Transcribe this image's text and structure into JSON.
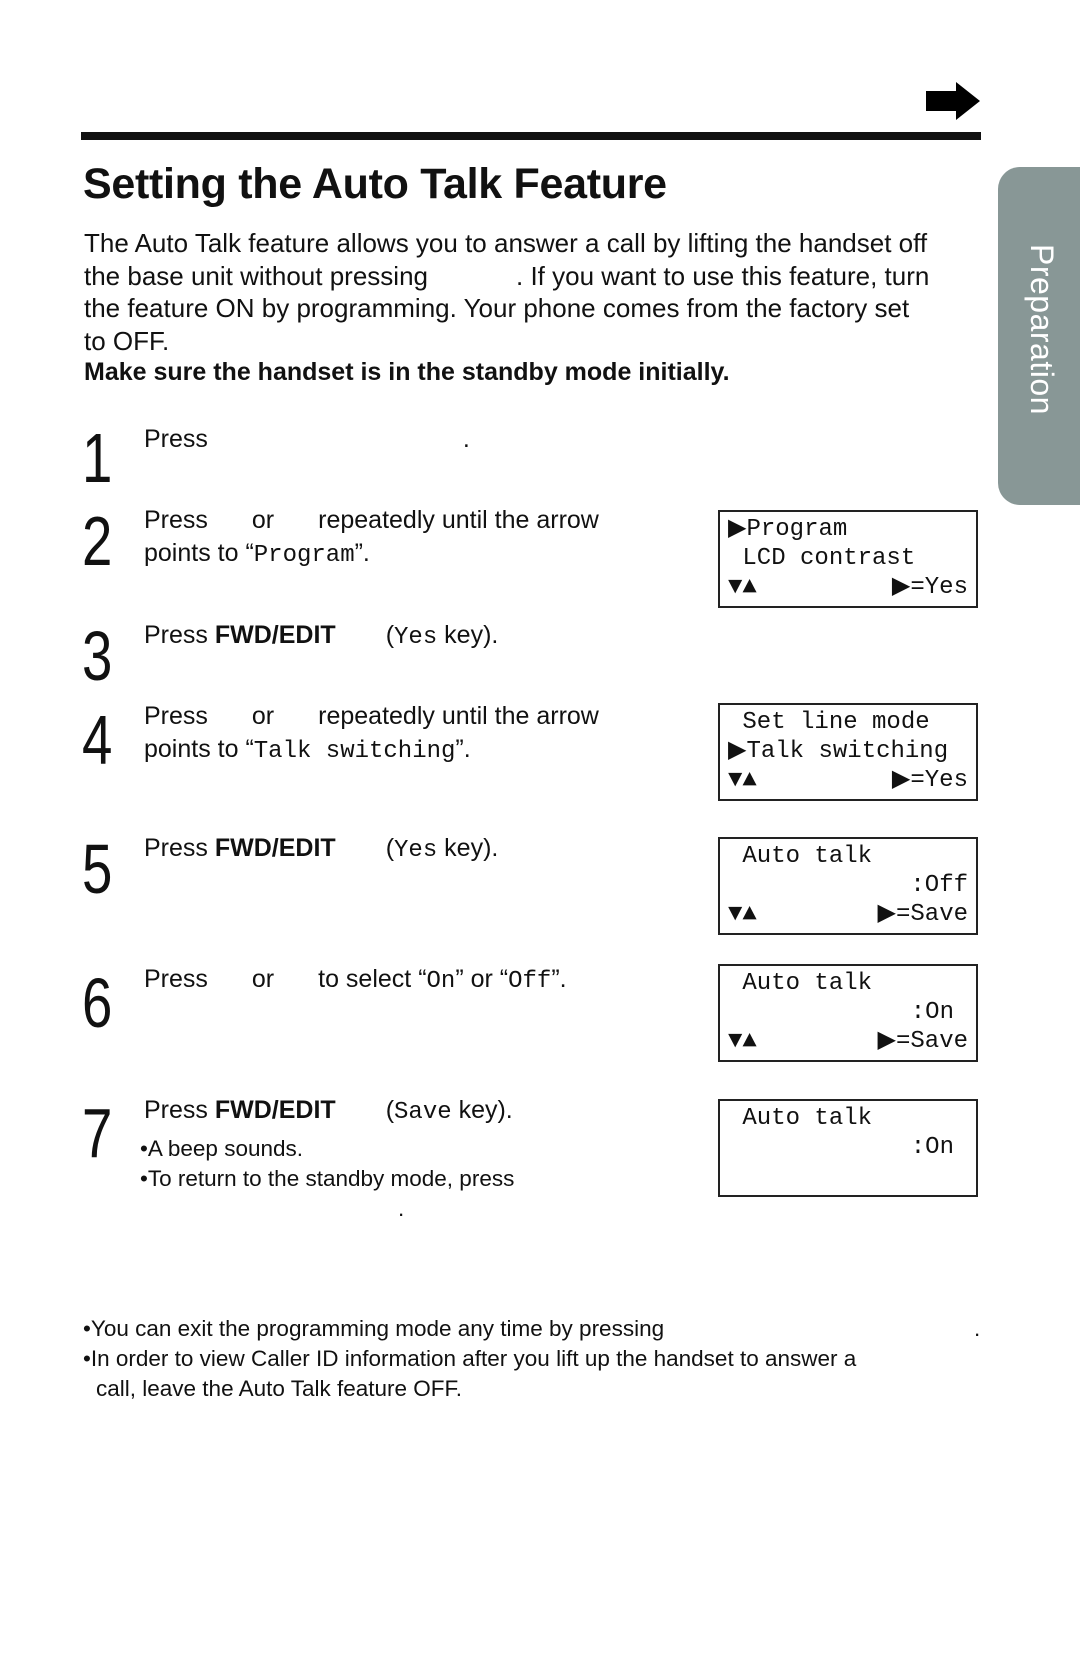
{
  "page": {
    "side_tab": "Preparation",
    "next_page_icon": "right-arrow-icon"
  },
  "header": {
    "title": "Setting the Auto Talk Feature"
  },
  "intro": {
    "line1": "The Auto Talk feature allows you to answer a call by lifting the handset off",
    "line2a": "the base unit without pressing",
    "line2b": ". If you want to use this feature, turn",
    "line3": "the feature ON by programming. Your phone comes from the factory set",
    "line4": "to OFF.",
    "note": "Make sure the handset is in the standby mode initially."
  },
  "steps": [
    {
      "num": "1",
      "a": "Press",
      "b": "."
    },
    {
      "num": "2",
      "a": "Press",
      "b": "or",
      "c": "repeatedly until the arrow",
      "d": "points to “",
      "code": "Program",
      "e": "”."
    },
    {
      "num": "3",
      "a": "Press ",
      "bold": "FWD/EDIT",
      "b": "(",
      "code": "Yes",
      "c": " key)."
    },
    {
      "num": "4",
      "a": "Press",
      "b": "or",
      "c": "repeatedly until the arrow",
      "d": "points to “",
      "code": "Talk switching",
      "e": "”."
    },
    {
      "num": "5",
      "a": "Press ",
      "bold": "FWD/EDIT",
      "b": "(",
      "code": "Yes",
      "c": " key)."
    },
    {
      "num": "6",
      "a": "Press",
      "b": "or",
      "c": "to select “",
      "code1": "On",
      "d": "” or “",
      "code2": "Off",
      "e": "”."
    },
    {
      "num": "7",
      "a": "Press ",
      "bold": "FWD/EDIT",
      "b": "(",
      "code": "Save",
      "c": " key).",
      "bullet1": "•A beep sounds.",
      "bullet2": "•To return to the standby mode, press",
      "bullet2_end": "."
    }
  ],
  "lcd_screens": [
    {
      "row1": "Program",
      "row1_arrow": true,
      "row2": " LCD contrast",
      "nav": "▼▲",
      "action": "▶=Yes"
    },
    {
      "row1": " Set line mode",
      "row2": "Talk switching",
      "row2_arrow": true,
      "nav": "▼▲",
      "action": "▶=Yes"
    },
    {
      "row1": " Auto talk",
      "row2": ":Off",
      "nav": "▼▲",
      "action": "▶=Save"
    },
    {
      "row1": " Auto talk",
      "row2": ":On",
      "nav": "▼▲",
      "action": "▶=Save"
    },
    {
      "row1": " Auto talk",
      "row2": ":On"
    }
  ],
  "notes": {
    "n1": "•You can exit the programming mode any time by pressing",
    "n1_end": ".",
    "n2a": "•In order to view Caller ID information after you lift up the handset to answer a",
    "n2b": "call, leave the Auto Talk feature OFF."
  }
}
